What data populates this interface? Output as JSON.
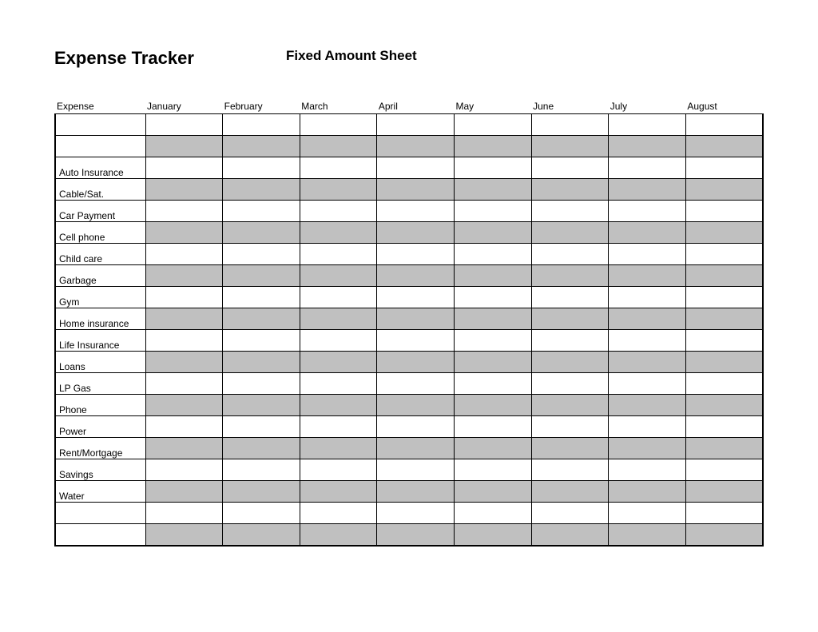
{
  "header": {
    "title": "Expense Tracker",
    "subtitle": "Fixed Amount Sheet"
  },
  "columns": [
    "Expense",
    "January",
    "February",
    "March",
    "April",
    "May",
    "June",
    "July",
    "August"
  ],
  "rows": [
    {
      "label": "",
      "shaded": false
    },
    {
      "label": "",
      "shaded": true
    },
    {
      "label": "Auto Insurance",
      "shaded": false
    },
    {
      "label": "Cable/Sat.",
      "shaded": true
    },
    {
      "label": "Car Payment",
      "shaded": false
    },
    {
      "label": "Cell phone",
      "shaded": true
    },
    {
      "label": "Child care",
      "shaded": false
    },
    {
      "label": "Garbage",
      "shaded": true
    },
    {
      "label": "Gym",
      "shaded": false
    },
    {
      "label": "Home insurance",
      "shaded": true
    },
    {
      "label": "Life Insurance",
      "shaded": false
    },
    {
      "label": "Loans",
      "shaded": true
    },
    {
      "label": "LP Gas",
      "shaded": false
    },
    {
      "label": "Phone",
      "shaded": true
    },
    {
      "label": "Power",
      "shaded": false
    },
    {
      "label": "Rent/Mortgage",
      "shaded": true
    },
    {
      "label": "Savings",
      "shaded": false
    },
    {
      "label": "Water",
      "shaded": true
    },
    {
      "label": "",
      "shaded": false
    },
    {
      "label": "",
      "shaded": true
    }
  ]
}
